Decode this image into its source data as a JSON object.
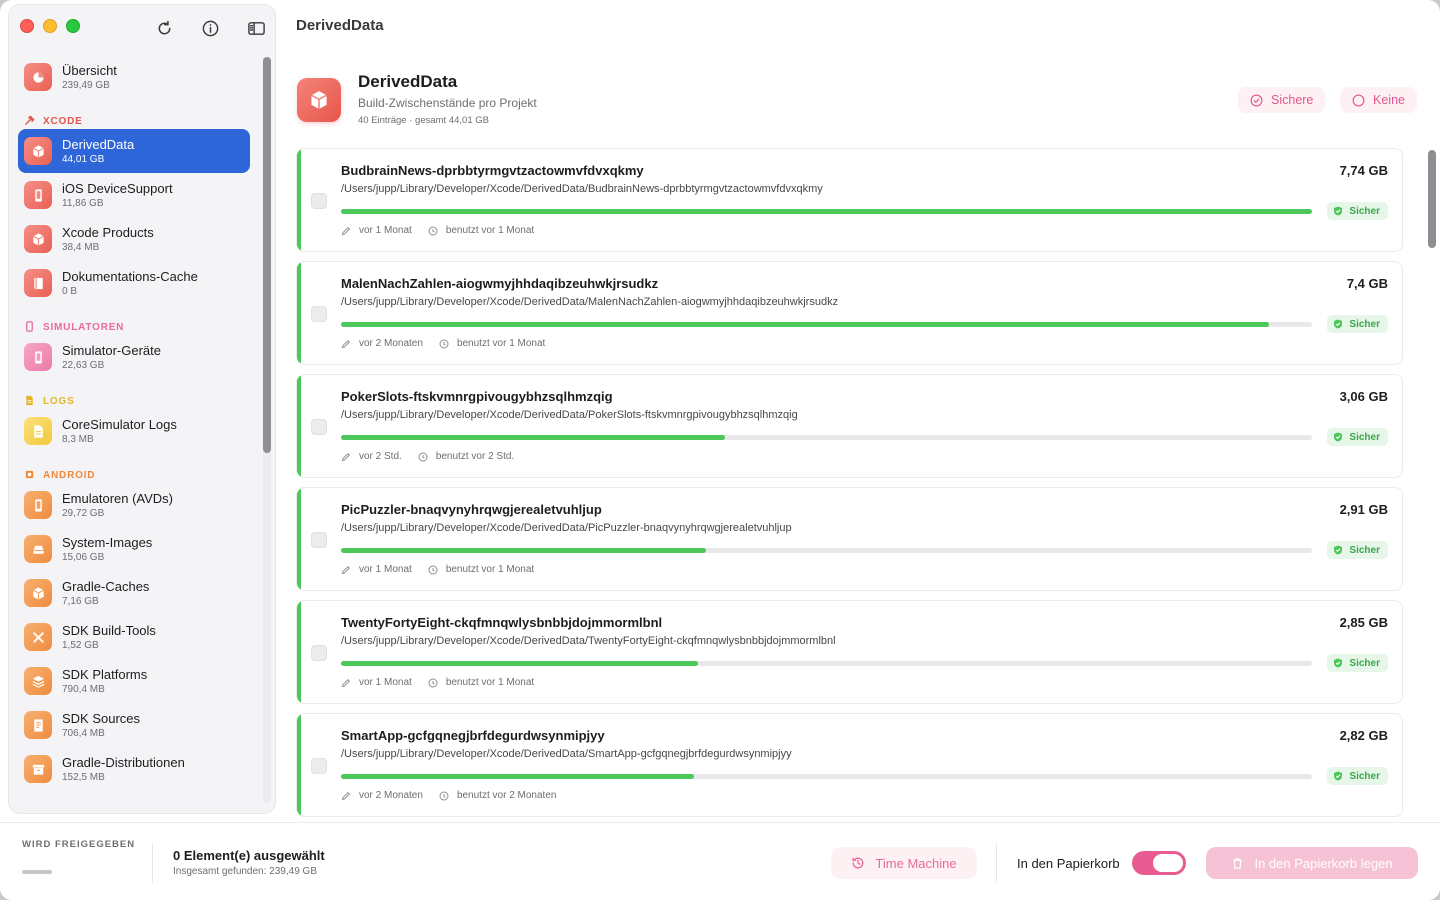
{
  "window": {
    "title": "DerivedData"
  },
  "toolbar": {
    "refresh_icon": "refresh-icon",
    "info_icon": "info-icon",
    "sidebar_icon": "sidebar-toggle-icon"
  },
  "sidebar": {
    "overview": {
      "name": "Übersicht",
      "size": "239,49 GB"
    },
    "sections": {
      "xcode": "XCODE",
      "simulators": "SIMULATOREN",
      "logs": "LOGS",
      "android": "ANDROID"
    },
    "xcode_items": [
      {
        "name": "DerivedData",
        "size": "44,01 GB"
      },
      {
        "name": "iOS DeviceSupport",
        "size": "11,86 GB"
      },
      {
        "name": "Xcode Products",
        "size": "38,4 MB"
      },
      {
        "name": "Dokumentations-Cache",
        "size": "0 B"
      }
    ],
    "simulator_items": [
      {
        "name": "Simulator-Geräte",
        "size": "22,63 GB"
      }
    ],
    "log_items": [
      {
        "name": "CoreSimulator Logs",
        "size": "8,3 MB"
      }
    ],
    "android_items": [
      {
        "name": "Emulatoren (AVDs)",
        "size": "29,72 GB"
      },
      {
        "name": "System-Images",
        "size": "15,06 GB"
      },
      {
        "name": "Gradle-Caches",
        "size": "7,16 GB"
      },
      {
        "name": "SDK Build-Tools",
        "size": "1,52 GB"
      },
      {
        "name": "SDK Platforms",
        "size": "790,4 MB"
      },
      {
        "name": "SDK Sources",
        "size": "706,4 MB"
      },
      {
        "name": "Gradle-Distributionen",
        "size": "152,5 MB"
      }
    ]
  },
  "header": {
    "title": "DerivedData",
    "subtitle": "Build-Zwischenstände pro Projekt",
    "meta": "40 Einträge · gesamt 44,01 GB",
    "safe_label": "Sichere",
    "none_label": "Keine"
  },
  "entries": [
    {
      "name": "BudbrainNews-dprbbtyrmgvtzactowmvfdvxqkmy",
      "path": "/Users/jupp/Library/Developer/Xcode/DerivedData/BudbrainNews-dprbbtyrmgvtzactowmvfdvxqkmy",
      "size": "7,74 GB",
      "fraction": 1.0,
      "badge": "Sicher",
      "modified": "vor 1 Monat",
      "used": "benutzt vor 1 Monat"
    },
    {
      "name": "MalenNachZahlen-aiogwmyjhhdaqibzeuhwkjrsudkz",
      "path": "/Users/jupp/Library/Developer/Xcode/DerivedData/MalenNachZahlen-aiogwmyjhhdaqibzeuhwkjrsudkz",
      "size": "7,4 GB",
      "fraction": 0.956,
      "badge": "Sicher",
      "modified": "vor 2 Monaten",
      "used": "benutzt vor 1 Monat"
    },
    {
      "name": "PokerSlots-ftskvmnrgpivougybhzsqlhmzqig",
      "path": "/Users/jupp/Library/Developer/Xcode/DerivedData/PokerSlots-ftskvmnrgpivougybhzsqlhmzqig",
      "size": "3,06 GB",
      "fraction": 0.395,
      "badge": "Sicher",
      "modified": "vor 2 Std.",
      "used": "benutzt vor 2 Std."
    },
    {
      "name": "PicPuzzler-bnaqvynyhrqwgjerealetvuhljup",
      "path": "/Users/jupp/Library/Developer/Xcode/DerivedData/PicPuzzler-bnaqvynyhrqwgjerealetvuhljup",
      "size": "2,91 GB",
      "fraction": 0.376,
      "badge": "Sicher",
      "modified": "vor 1 Monat",
      "used": "benutzt vor 1 Monat"
    },
    {
      "name": "TwentyFortyEight-ckqfmnqwlysbnbbjdojmmormlbnl",
      "path": "/Users/jupp/Library/Developer/Xcode/DerivedData/TwentyFortyEight-ckqfmnqwlysbnbbjdojmmormlbnl",
      "size": "2,85 GB",
      "fraction": 0.368,
      "badge": "Sicher",
      "modified": "vor 1 Monat",
      "used": "benutzt vor 1 Monat"
    },
    {
      "name": "SmartApp-gcfgqnegjbrfdegurdwsynmipjyy",
      "path": "/Users/jupp/Library/Developer/Xcode/DerivedData/SmartApp-gcfgqnegjbrfdegurdwsynmipjyy",
      "size": "2,82 GB",
      "fraction": 0.364,
      "badge": "Sicher",
      "modified": "vor 2 Monaten",
      "used": "benutzt vor 2 Monaten"
    }
  ],
  "footer": {
    "releasing_label": "WIRD FREIGEGEBEN",
    "selected": "0 Element(e) ausgewählt",
    "found": "Insgesamt gefunden: 239,49 GB",
    "time_machine": "Time Machine",
    "trash_toggle_label": "In den Papierkorb",
    "trash_toggle_on": true,
    "trash_button": "In den Papierkorb legen"
  },
  "colors": {
    "accent": "#2e66d9",
    "pink": "#e85c92",
    "green": "#4cc75a",
    "xcode": "#e2574c",
    "simulator": "#e86aa0",
    "logs": "#e5b42a",
    "android": "#ed8a3a"
  }
}
